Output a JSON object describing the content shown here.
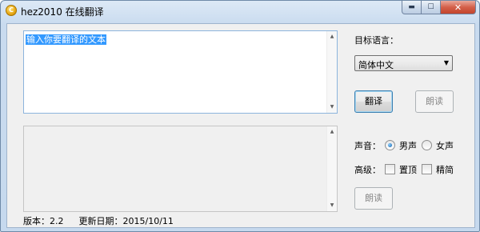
{
  "window": {
    "title": "hez2010 在线翻译",
    "app_icon_glyph": "C"
  },
  "caption_buttons": {
    "minimize": "▬",
    "maximize": "☐",
    "close": "✕"
  },
  "input_box": {
    "text": "输入你要翻译的文本"
  },
  "output_box": {
    "text": ""
  },
  "target_language": {
    "label": "目标语言：",
    "selected": "简体中文",
    "dropdown_glyph": "▼"
  },
  "buttons": {
    "translate": "翻译",
    "read_aloud_top": "朗读",
    "read_aloud_bottom": "朗读"
  },
  "voice": {
    "label": "声音：",
    "options": [
      "男声",
      "女声"
    ],
    "selected": "男声"
  },
  "advanced": {
    "label": "高级：",
    "topmost": "置顶",
    "simplified": "精简"
  },
  "status": {
    "version": "版本：2.2",
    "updated": "更新日期：2015/10/11"
  },
  "scrollbar": {
    "up": "▲",
    "down": "▼"
  }
}
